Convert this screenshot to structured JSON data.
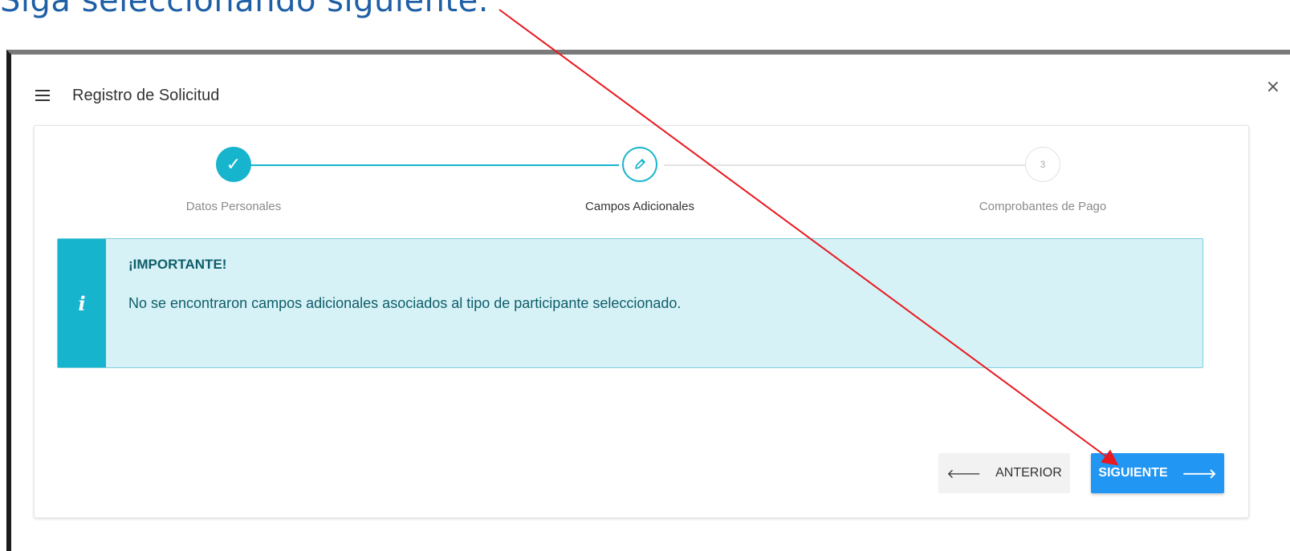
{
  "instruction": "Siga seleccionando siguiente.",
  "header": {
    "title": "Registro de Solicitud",
    "close_label": "×"
  },
  "stepper": {
    "steps": [
      {
        "label": "Datos Personales",
        "state": "completed",
        "icon": "check-icon"
      },
      {
        "label": "Campos Adicionales",
        "state": "active",
        "icon": "pencil-icon"
      },
      {
        "label": "Comprobantes de Pago",
        "state": "pending",
        "number": "3"
      }
    ]
  },
  "alert": {
    "title": "¡IMPORTANTE!",
    "message": "No se encontraron campos adicionales asociados al tipo de participante seleccionado.",
    "icon": "info-icon"
  },
  "buttons": {
    "prev_label": "ANTERIOR",
    "next_label": "SIGUIENTE"
  },
  "colors": {
    "accent": "#17b4cd",
    "primary_button": "#2196f3",
    "alert_bg": "#d6f2f6",
    "annotation_arrow": "#e8191f",
    "instruction_text": "#1f5fa6"
  }
}
